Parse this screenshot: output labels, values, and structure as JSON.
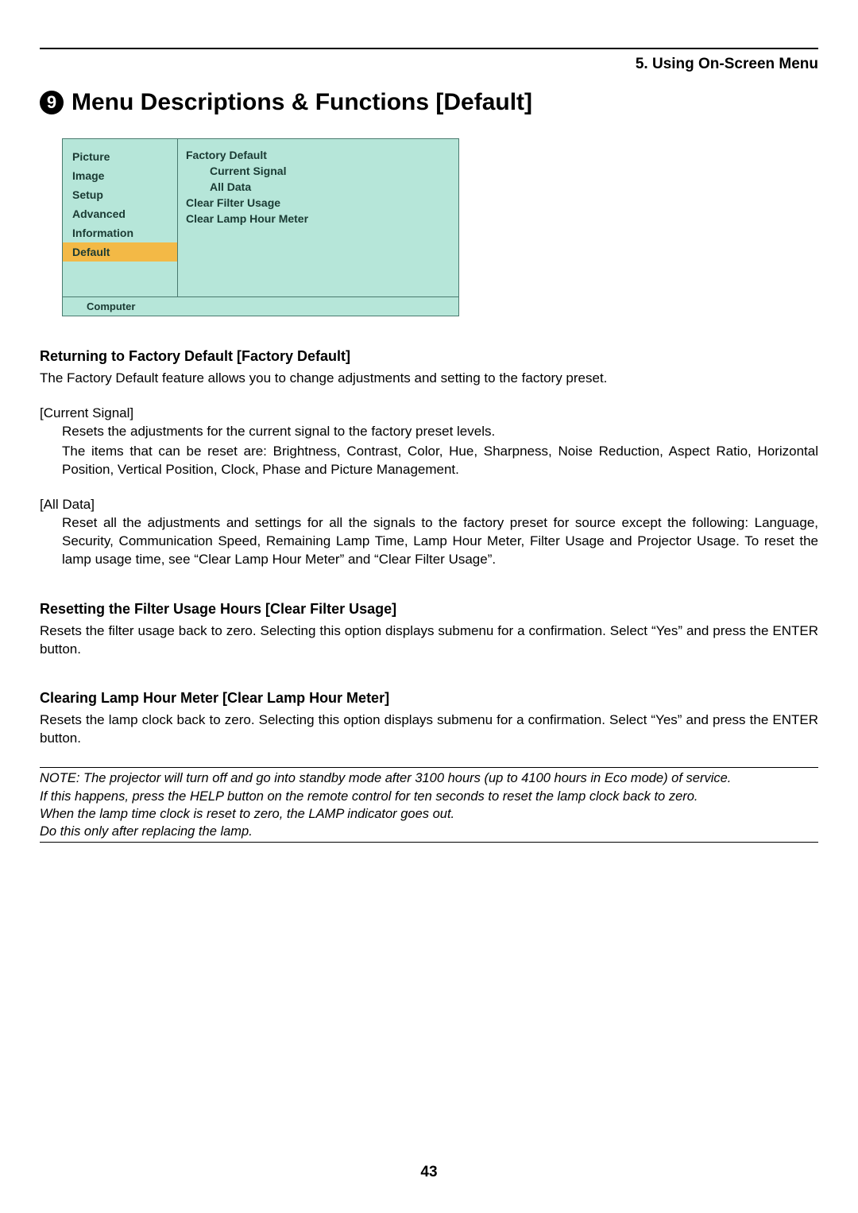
{
  "chapter": "5. Using On-Screen Menu",
  "section_number": "9",
  "section_title": "Menu Descriptions & Functions [Default]",
  "menu": {
    "list": [
      "Picture",
      "Image",
      "Setup",
      "Advanced",
      "Information",
      "Default"
    ],
    "selected_index": 5,
    "panel": {
      "factory_default": "Factory Default",
      "current_signal": "Current Signal",
      "all_data": "All Data",
      "clear_filter": "Clear Filter Usage",
      "clear_lamp": "Clear Lamp Hour Meter"
    },
    "footer": "Computer"
  },
  "sec1": {
    "heading": "Returning to Factory Default [Factory Default]",
    "intro": "The Factory Default feature allows you to change adjustments and setting to the factory preset.",
    "cs_label": "[Current Signal]",
    "cs_l1": "Resets the adjustments for the current signal to the factory preset levels.",
    "cs_l2": "The items that can be reset are: Brightness, Contrast, Color, Hue, Sharpness, Noise Reduction, Aspect Ratio, Horizontal Position, Vertical Position, Clock, Phase and Picture Management.",
    "ad_label": "[All Data]",
    "ad_l1": "Reset all the adjustments and settings for all the signals to the factory preset for source except the following: Language, Security, Communication Speed, Remaining Lamp Time, Lamp Hour Meter, Filter Usage and Projector Usage. To reset the lamp usage time, see “Clear Lamp Hour Meter” and “Clear Filter Usage”."
  },
  "sec2": {
    "heading": "Resetting the Filter Usage Hours [Clear Filter Usage]",
    "body": "Resets the filter usage back to zero. Selecting this option displays submenu for a confirmation. Select “Yes” and press the ENTER button."
  },
  "sec3": {
    "heading": "Clearing Lamp Hour Meter [Clear Lamp Hour Meter]",
    "body": "Resets the lamp clock back to zero. Selecting this option displays submenu for a confirmation. Select “Yes” and press the ENTER button."
  },
  "note": {
    "l1": "NOTE: The projector will turn off and go into standby mode after 3100 hours (up to 4100 hours in Eco mode) of service.",
    "l2": "If this happens, press the HELP button on the remote control for ten seconds to reset the lamp clock back to zero.",
    "l3": "When the lamp time clock is reset to zero, the LAMP indicator goes out.",
    "l4": "Do this only after replacing the lamp."
  },
  "page_number": "43"
}
